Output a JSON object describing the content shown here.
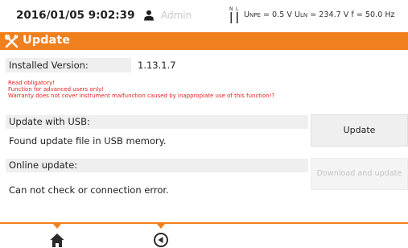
{
  "status": {
    "datetime": "2016/01/05 9:02:39",
    "user": "Admin",
    "user_icon": "user-icon",
    "probe_icon": "probe-connection-icon",
    "unpe_label": "U",
    "unpe_sub": "NPE",
    "unpe_value": " = 0.5 V ",
    "uln_label": "U",
    "uln_sub": "LN",
    "uln_value": " = 234.7 V f = 50.0 Hz"
  },
  "title": {
    "text": "Update",
    "icon": "tools-icon"
  },
  "installed": {
    "label": "Installed Version:",
    "value": "1.13.1.7"
  },
  "warning": {
    "line1": "Read obligatory!",
    "line2": "Function for advanced users only!",
    "line3": "Warranty does not cover instrument malfunction caused by inappropiate use of this function!?"
  },
  "usb": {
    "label": "Update with USB:",
    "status": "Found update file in USB memory.",
    "button": "Update"
  },
  "online": {
    "label": "Online update:",
    "status": "Can not check or connection error.",
    "button": "Download and update"
  },
  "nav": {
    "home_icon": "home-icon",
    "back_icon": "back-icon"
  },
  "colors": {
    "accent": "#f07f1e",
    "warning": "#e52020",
    "disabled_text": "#c4c4c4",
    "field_bg": "#efefef"
  }
}
